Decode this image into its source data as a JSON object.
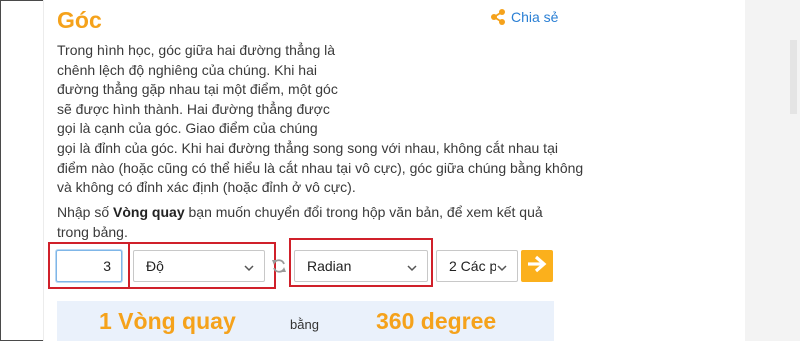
{
  "page": {
    "title": "Góc",
    "share_label": "Chia sẻ"
  },
  "description": {
    "lines": [
      "Trong hình học, góc giữa hai đường thẳng là",
      "chênh lệch độ nghiêng của chúng. Khi hai",
      "đường thẳng gặp nhau tại một điểm, một góc",
      "sẽ được hình thành. Hai đường thẳng được",
      "gọi là cạnh của góc. Giao điểm của chúng",
      "gọi là đỉnh của góc. Khi hai đường thẳng song song với nhau, không cắt nhau tại",
      "điểm nào (hoặc cũng có thể hiểu là cắt nhau tại vô cực), góc giữa chúng bằng không",
      "và không có đỉnh xác định (hoặc đỉnh ở vô cực)."
    ]
  },
  "instruction": {
    "before": "Nhập số ",
    "bold": "Vòng quay",
    "after": " bạn muốn chuyển đổi trong hộp văn bản, để xem kết quả trong bảng."
  },
  "converter": {
    "input_value": "3",
    "from_unit": "Độ",
    "to_unit": "Radian",
    "precision": "2 Các p"
  },
  "result": {
    "left": "1 Vòng quay",
    "middle": "bằng",
    "right": "360 degree"
  },
  "colors": {
    "accent": "#f5a21b",
    "link": "#2a7fd4",
    "highlight": "#d0202a",
    "result_bg": "#eaf1fb"
  }
}
